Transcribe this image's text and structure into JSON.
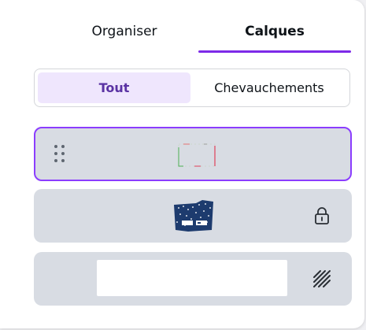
{
  "tabs": {
    "organiser": "Organiser",
    "calques": "Calques",
    "active": "calques"
  },
  "filter": {
    "tout": "Tout",
    "chevauchements": "Chevauchements",
    "active": "tout"
  },
  "layers": [
    {
      "type": "graphic-frame",
      "selected": true,
      "icon": "drag-handle-icon"
    },
    {
      "type": "image",
      "locked": true,
      "icon": "lock-icon"
    },
    {
      "type": "background",
      "icon": "transparency-pattern-icon"
    }
  ],
  "colors": {
    "accent": "#7d2ae8",
    "selected_border": "#8b3dff",
    "segment_active_bg": "#efe6fd",
    "layer_bg": "#d8dce3"
  }
}
